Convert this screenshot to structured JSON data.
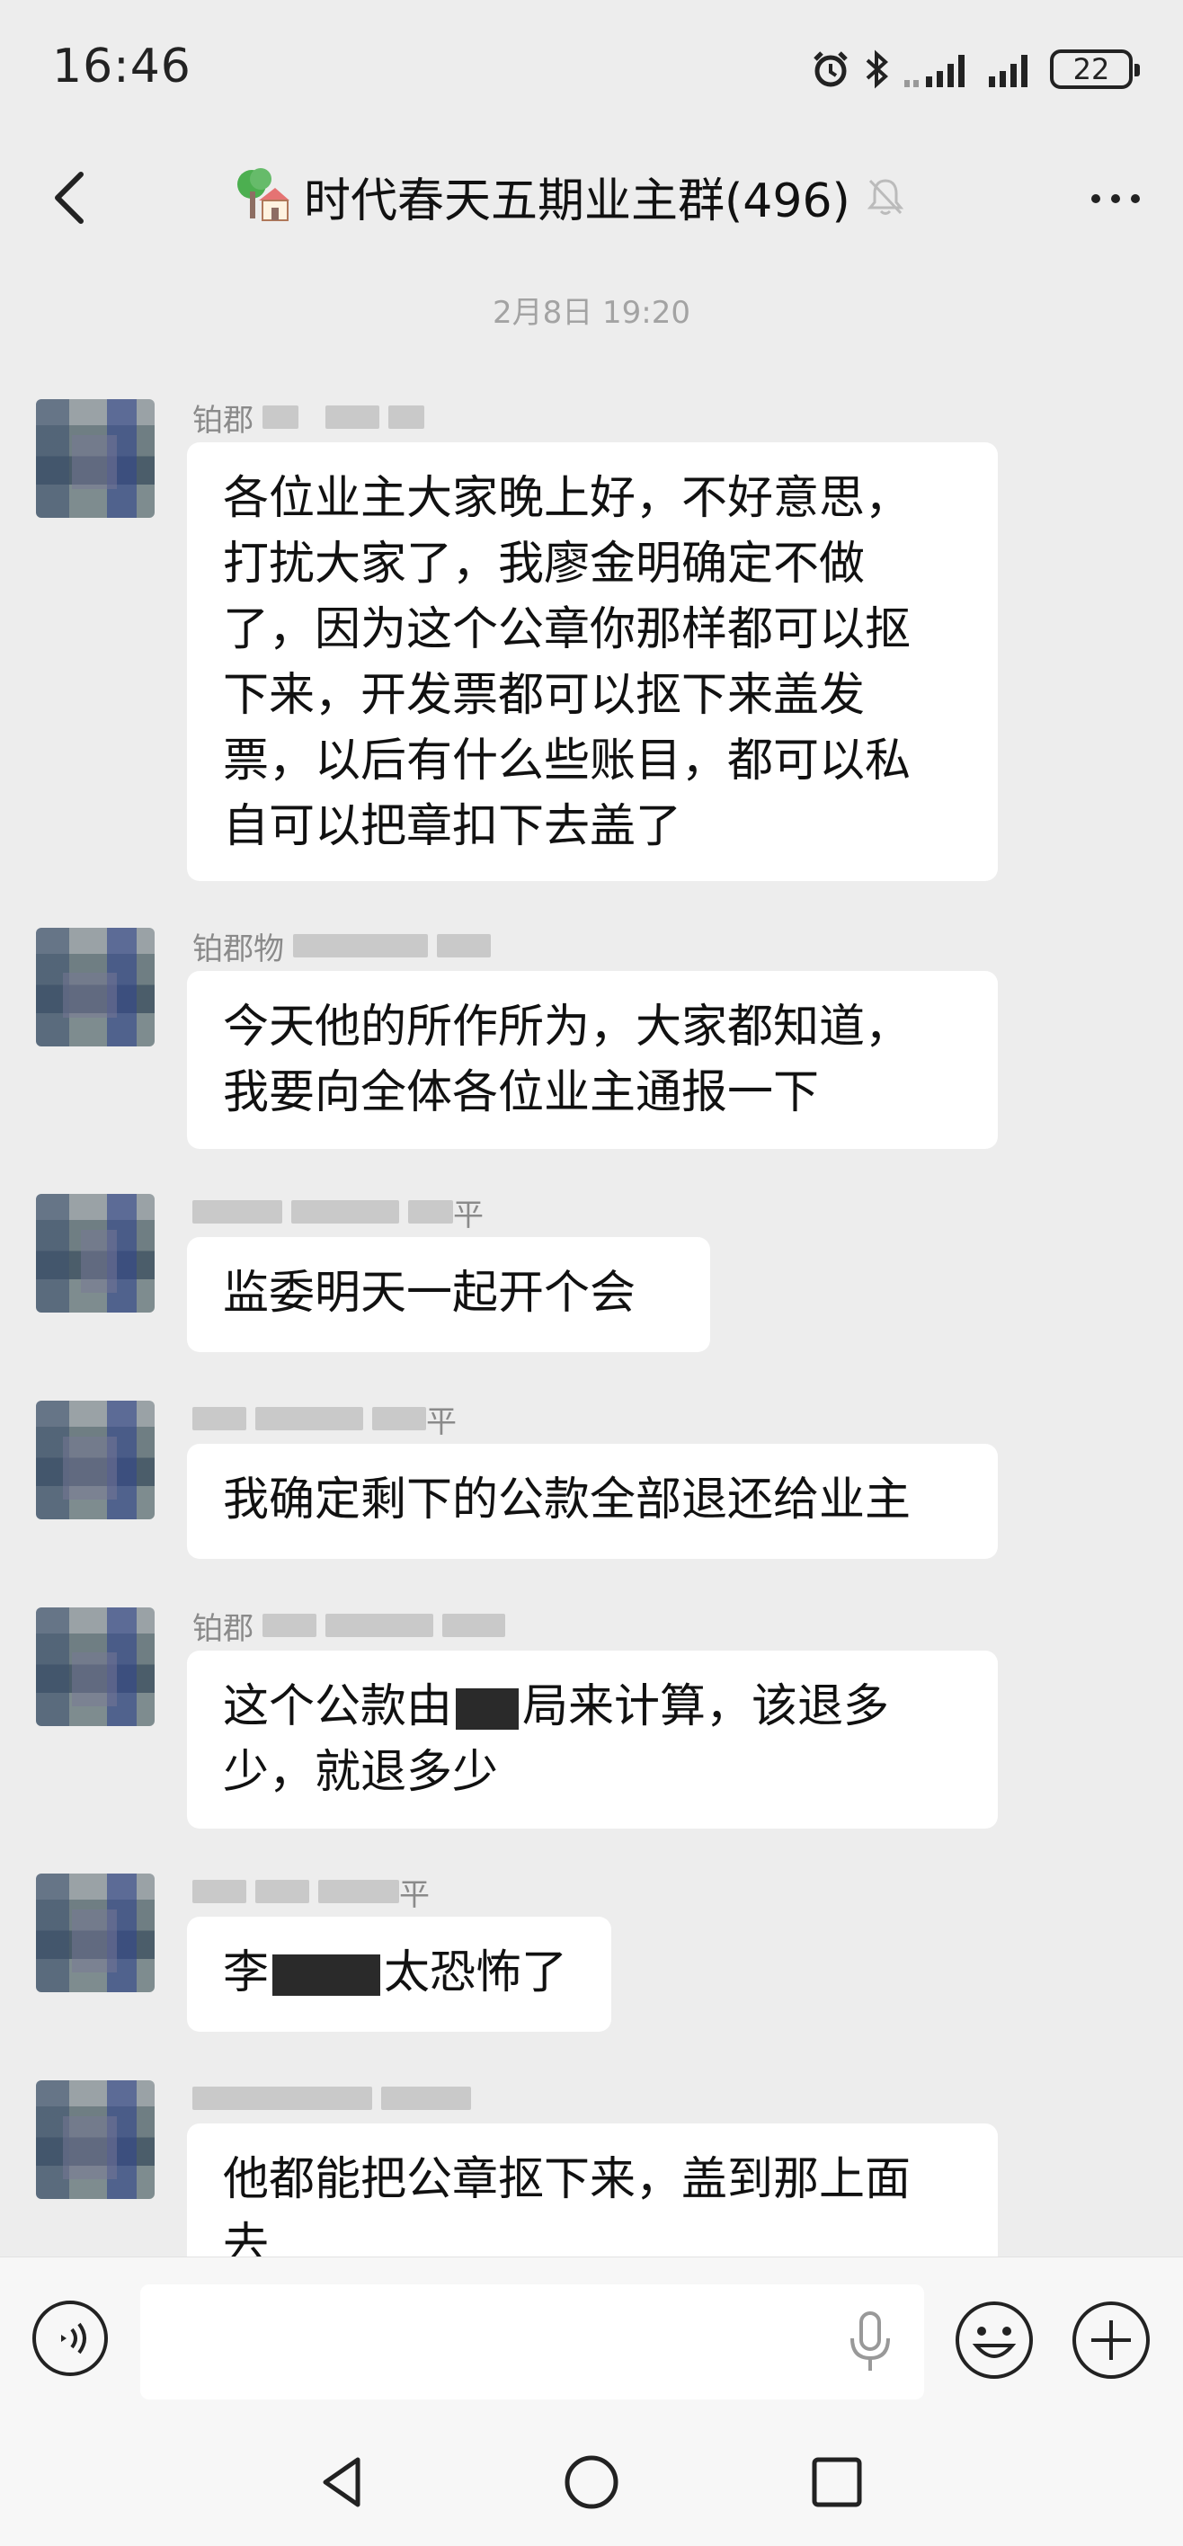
{
  "status_bar": {
    "time": "16:46",
    "battery": "22",
    "icons": [
      "alarm-icon",
      "bluetooth-icon",
      "signal-icon",
      "signal-icon",
      "battery-icon"
    ]
  },
  "header": {
    "title": "时代春天五期业主群(496)",
    "emoji_icon": "house-tree-icon",
    "mute_icon": "bell-muted-icon",
    "back_icon": "chevron-left-icon",
    "more_icon": "more-dots-icon"
  },
  "chat": {
    "timestamp": "2月8日 19:20",
    "messages": [
      {
        "sender": "铂郡",
        "text": "各位业主大家晚上好，不好意思，\n打扰大家了，我廖金明确定不做\n了，因为这个公章你那样都可以抠\n下来，开发票都可以抠下来盖发\n票，以后有什么些账目，都可以私\n自可以把章扣下去盖了"
      },
      {
        "sender": "铂郡物",
        "text": "今天他的所作所为，大家都知道，\n我要向全体各位业主通报一下"
      },
      {
        "sender": "平",
        "text": "监委明天一起开个会"
      },
      {
        "sender": "平",
        "text": "我确定剩下的公款全部退还给业主"
      },
      {
        "sender": "铂郡",
        "text_before": "这个公款由",
        "text_after": "局来计算，该退多\n少，就退多少"
      },
      {
        "sender": "平",
        "text_before": "李",
        "text_after": "太恐怖了"
      },
      {
        "sender": "",
        "text": "他都能把公章抠下来，盖到那上面\n去"
      }
    ]
  },
  "input_bar": {
    "placeholder": ""
  },
  "colors": {
    "background": "#ededed",
    "bubble": "#ffffff",
    "meta_text": "#a3a3a3"
  }
}
